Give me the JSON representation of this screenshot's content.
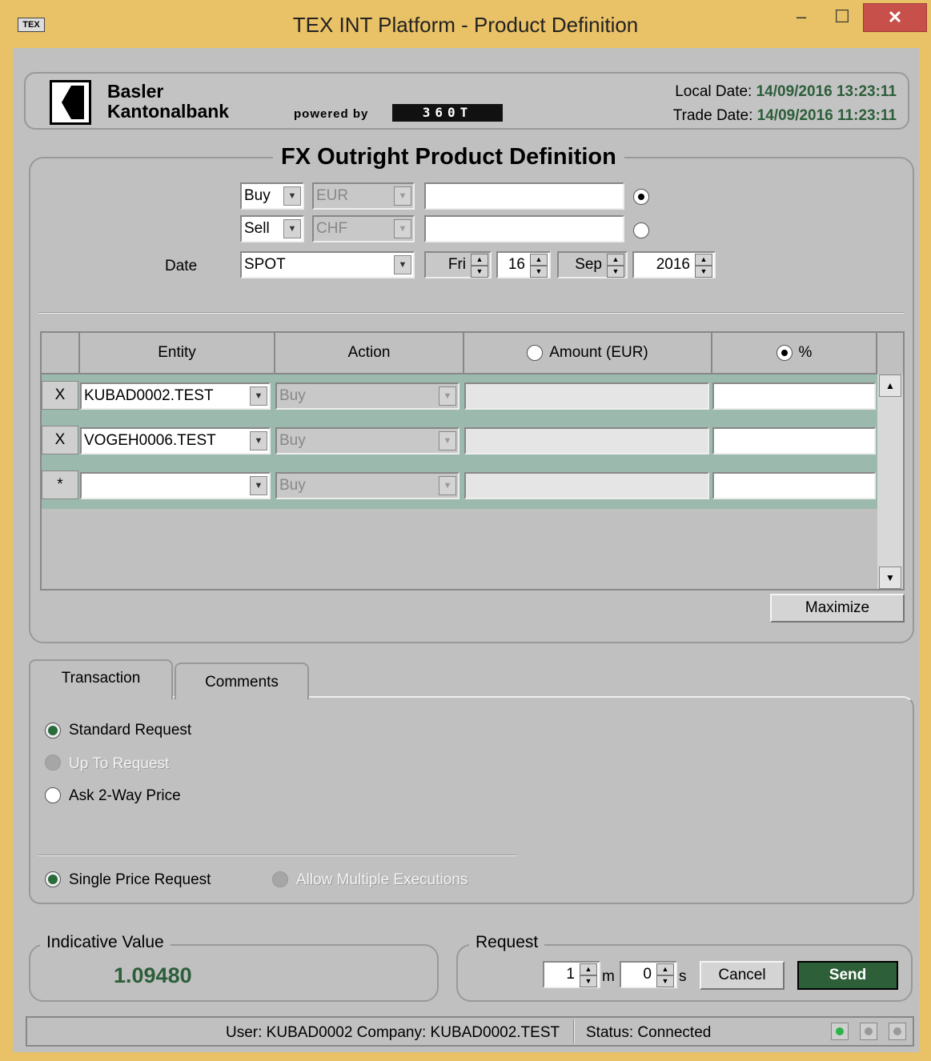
{
  "window": {
    "icon_text": "TEX",
    "title": "TEX INT Platform - Product Definition",
    "min": "–",
    "max": "☐",
    "close": "✕"
  },
  "header": {
    "bank_line1": "Basler",
    "bank_line2": "Kantonalbank",
    "powered_by": "powered by",
    "partner": "360T",
    "local_date_label": "Local Date:",
    "local_date": "14/09/2016 13:23:11",
    "trade_date_label": "Trade Date:",
    "trade_date": "14/09/2016 11:23:11"
  },
  "product": {
    "title": "FX Outright Product Definition",
    "leg1": {
      "side": "Buy",
      "currency": "EUR",
      "amount": "",
      "selected": true
    },
    "leg2": {
      "side": "Sell",
      "currency": "CHF",
      "amount": "",
      "selected": false
    },
    "date_label": "Date",
    "tenor": "SPOT",
    "day_of_week": "Fri",
    "day": "16",
    "month": "Sep",
    "year": "2016"
  },
  "allocation": {
    "headers": {
      "entity": "Entity",
      "action": "Action",
      "amount": "Amount (EUR)",
      "percent": "%"
    },
    "mode_percent": true,
    "rows": [
      {
        "marker": "X",
        "entity": "KUBAD0002.TEST",
        "action": "Buy",
        "amount": "",
        "percent": ""
      },
      {
        "marker": "X",
        "entity": "VOGEH0006.TEST",
        "action": "Buy",
        "amount": "",
        "percent": ""
      },
      {
        "marker": "*",
        "entity": "",
        "action": "Buy",
        "amount": "",
        "percent": ""
      }
    ],
    "maximize_label": "Maximize"
  },
  "tabs": {
    "transaction": "Transaction",
    "comments": "Comments",
    "active": "Transaction"
  },
  "transaction": {
    "standard": "Standard Request",
    "up_to": "Up To Request",
    "two_way": "Ask 2-Way Price",
    "single": "Single Price Request",
    "multiple": "Allow Multiple Executions"
  },
  "indicative": {
    "label": "Indicative Value",
    "value": "1.09480"
  },
  "request": {
    "label": "Request",
    "minutes": "1",
    "min_unit": "m",
    "seconds": "0",
    "sec_unit": "s",
    "cancel": "Cancel",
    "send": "Send"
  },
  "status": {
    "user": "User: KUBAD0002 Company: KUBAD0002.TEST",
    "status": "Status:  Connected"
  },
  "colors": {
    "accent_green": "#2d5f38",
    "grid_row": "#9bb9ad",
    "window_frame": "#e9c166"
  }
}
